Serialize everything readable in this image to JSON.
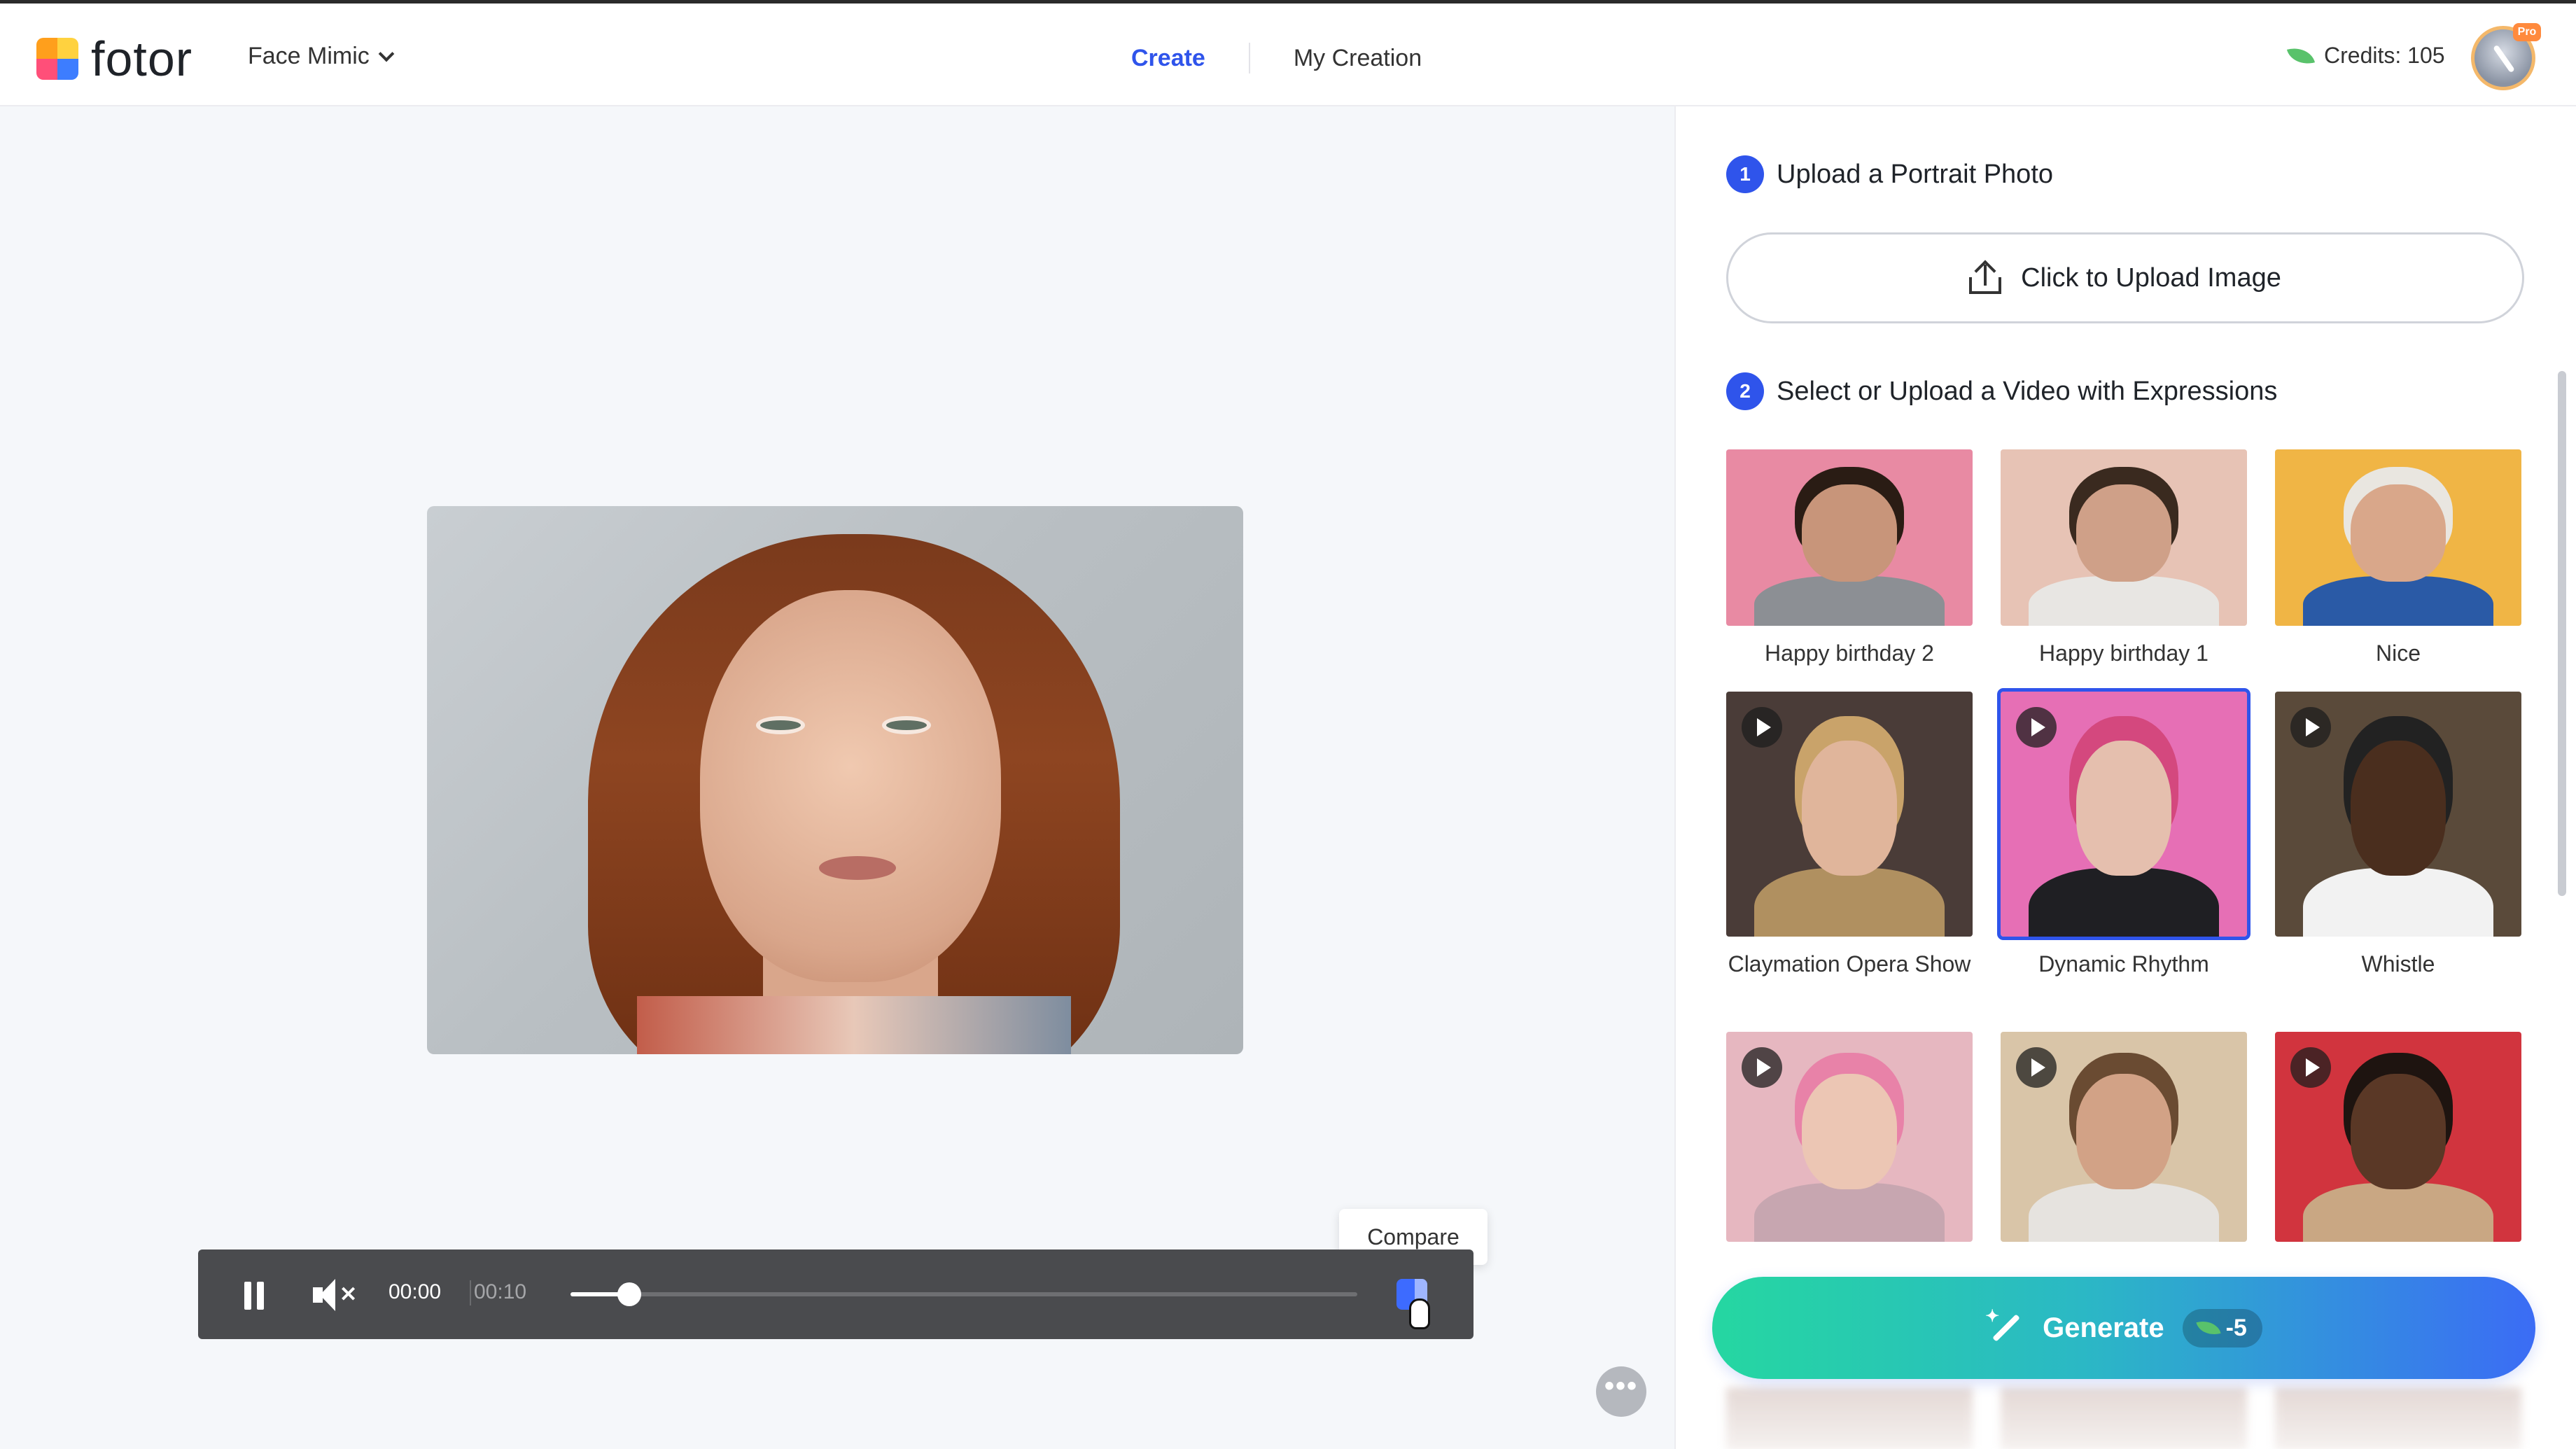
{
  "header": {
    "logo_text": "fotor",
    "tool_label": "Face Mimic",
    "nav": {
      "create": "Create",
      "my_creation": "My Creation"
    },
    "credits_label": "Credits: 105",
    "pro_badge": "Pro"
  },
  "player": {
    "current_time": "00:00",
    "total_time": "00:10",
    "progress_fraction": 0.075,
    "compare_tooltip": "Compare"
  },
  "more_button": "•••",
  "panel": {
    "step1": {
      "number": "1",
      "title": "Upload a Portrait Photo",
      "upload_label": "Click to Upload Image"
    },
    "step2": {
      "number": "2",
      "title": "Select or Upload a Video with Expressions"
    },
    "templates": [
      {
        "label": "Happy birthday 2",
        "has_play": false,
        "selected": false,
        "bg": "#e88aa3",
        "skin": "#c8957a",
        "hair": "#2a1c14",
        "shirt": "#8c8f94"
      },
      {
        "label": "Happy birthday 1",
        "has_play": false,
        "selected": false,
        "bg": "#e7c3b5",
        "skin": "#cfa088",
        "hair": "#3a2a1f",
        "shirt": "#e8e6e3"
      },
      {
        "label": "Nice",
        "has_play": false,
        "selected": false,
        "bg": "#f0b545",
        "skin": "#d9a78a",
        "hair": "#e9e6e0",
        "shirt": "#2a5aa6"
      },
      {
        "label": "Claymation Opera Show",
        "has_play": true,
        "selected": false,
        "bg": "#4a3c38",
        "skin": "#e0b59b",
        "hair": "#c9a36a",
        "shirt": "#b09060"
      },
      {
        "label": "Dynamic Rhythm",
        "has_play": true,
        "selected": true,
        "bg": "#e66fb5",
        "skin": "#e5bfae",
        "hair": "#d4487e",
        "shirt": "#1f1f23"
      },
      {
        "label": "Whistle",
        "has_play": true,
        "selected": false,
        "bg": "#5a4a3a",
        "skin": "#4a2e1e",
        "hair": "#222222",
        "shirt": "#f2f2f2"
      },
      {
        "label": "",
        "has_play": true,
        "selected": false,
        "bg": "#e6b7c0",
        "skin": "#ecc6b4",
        "hair": "#e882a8",
        "shirt": "#c7a6b0"
      },
      {
        "label": "",
        "has_play": true,
        "selected": false,
        "bg": "#d9c5a8",
        "skin": "#d2a286",
        "hair": "#6a4b32",
        "shirt": "#e6e3df"
      },
      {
        "label": "",
        "has_play": true,
        "selected": false,
        "bg": "#d1343e",
        "skin": "#5a3826",
        "hair": "#1e1410",
        "shirt": "#c9a783"
      }
    ],
    "generate": {
      "label": "Generate",
      "cost": "-5"
    }
  },
  "colors": {
    "accent": "#2f54eb",
    "generate_start": "#25d7a1",
    "generate_end": "#3b6cf5",
    "player_bg": "#4a4b4e"
  }
}
